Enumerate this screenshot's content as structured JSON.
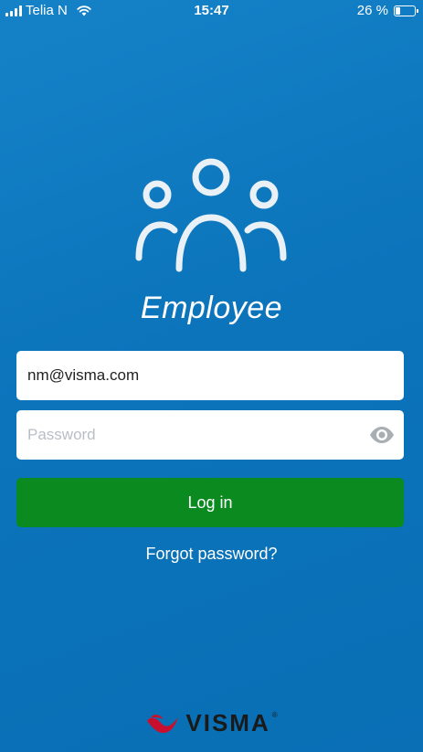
{
  "status_bar": {
    "carrier": "Telia N",
    "time": "15:47",
    "battery_text": "26 %",
    "battery_level": 0.26
  },
  "app": {
    "name": "Employee",
    "logo_icon": "people-group-icon"
  },
  "login_form": {
    "email_value": "nm@visma.com",
    "password_value": "",
    "password_placeholder": "Password",
    "show_password_icon": "eye-icon",
    "login_label": "Log in",
    "forgot_label": "Forgot password?"
  },
  "brand": {
    "name": "VISMA",
    "mark": "®",
    "icon": "visma-swoosh-icon",
    "color": "#c8102e"
  },
  "colors": {
    "background": "#0b74bb",
    "button": "#0b8a1f",
    "brand_red": "#c8102e"
  }
}
